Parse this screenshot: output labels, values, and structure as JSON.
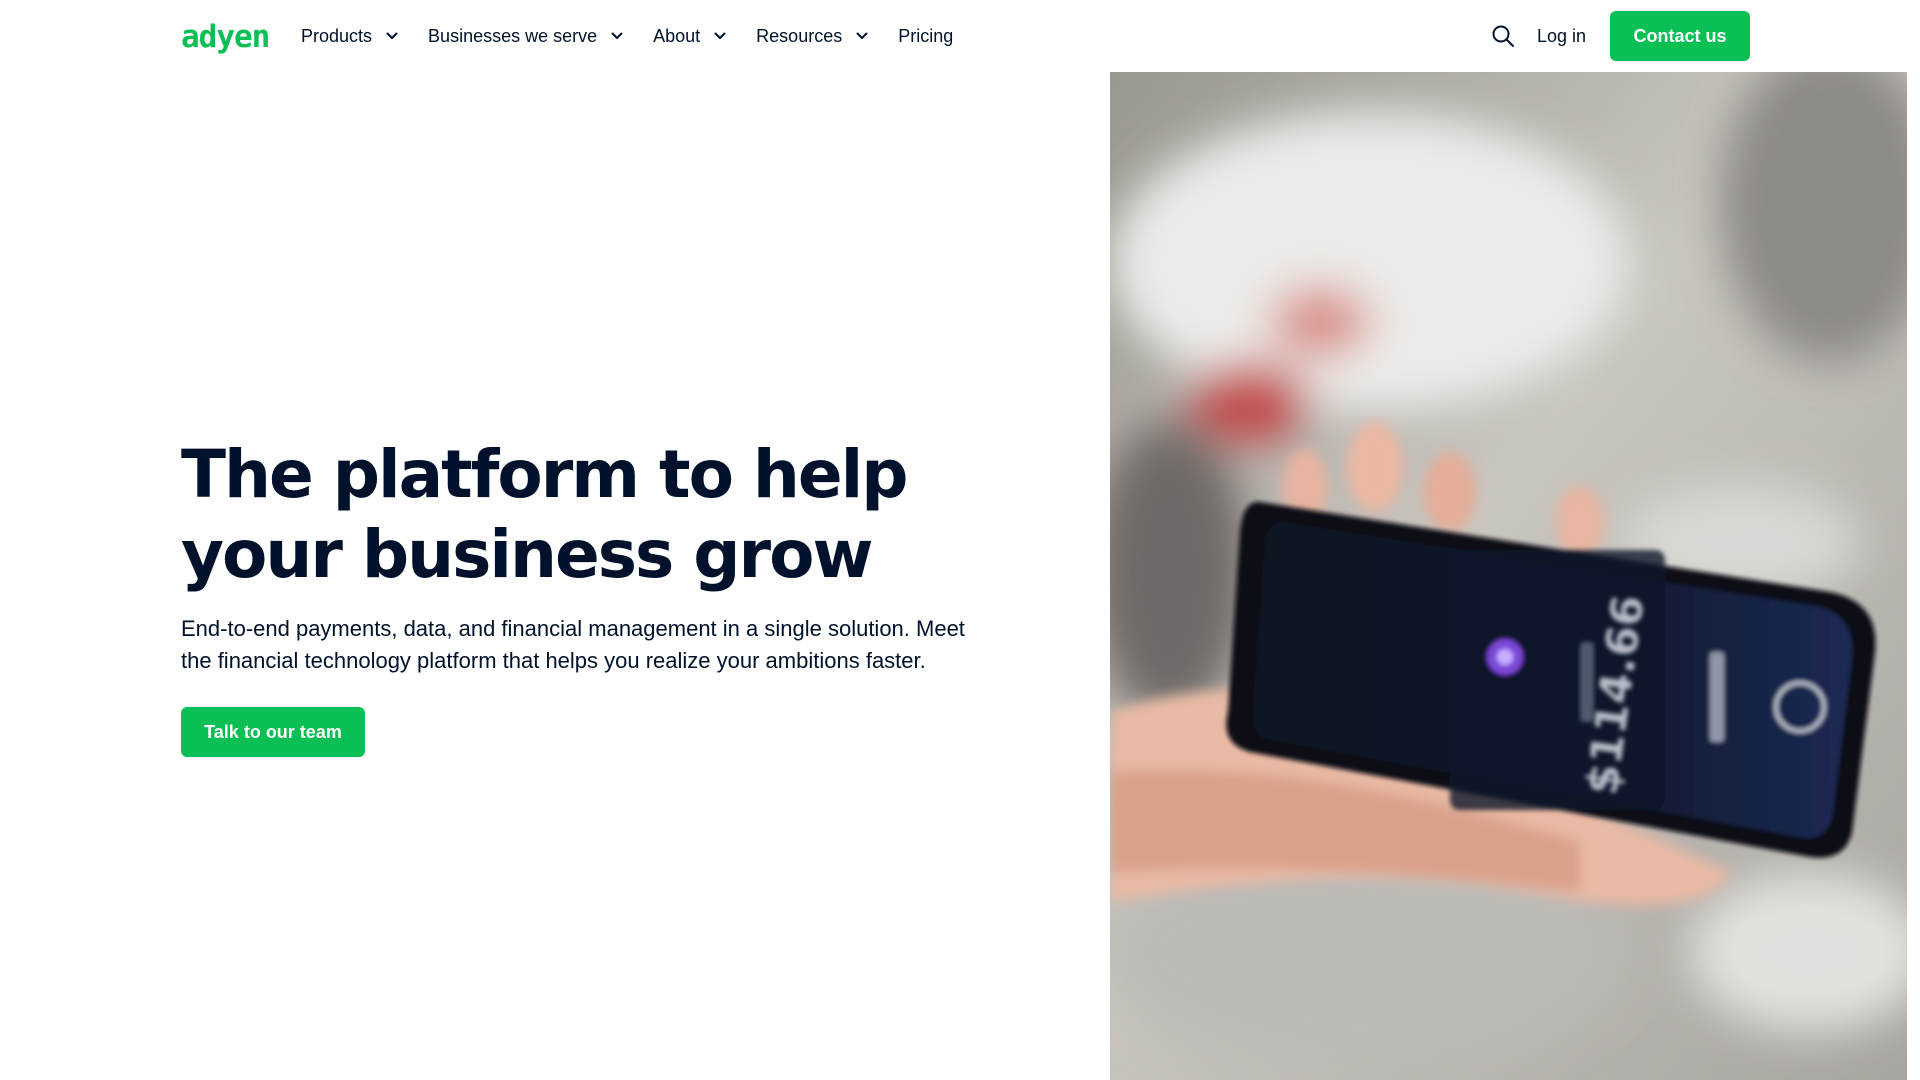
{
  "brand": {
    "logo_text": "adyen",
    "accent_color": "#0abf53",
    "text_color": "#00112c"
  },
  "nav": {
    "items": [
      {
        "label": "Products",
        "has_dropdown": true
      },
      {
        "label": "Businesses we serve",
        "has_dropdown": true
      },
      {
        "label": "About",
        "has_dropdown": true
      },
      {
        "label": "Resources",
        "has_dropdown": true
      },
      {
        "label": "Pricing",
        "has_dropdown": false
      }
    ],
    "search_icon": "search-icon",
    "login_label": "Log in",
    "contact_label": "Contact us"
  },
  "hero": {
    "title": "The platform to help your business grow",
    "subtitle": "End-to-end payments, data, and financial management in a single solution. Meet the financial technology platform that helps you realize your ambitions faster.",
    "cta_label": "Talk to our team",
    "media": {
      "alt": "Hand holding a phone showing a payment amount",
      "phone_amount": "$114.66"
    }
  }
}
